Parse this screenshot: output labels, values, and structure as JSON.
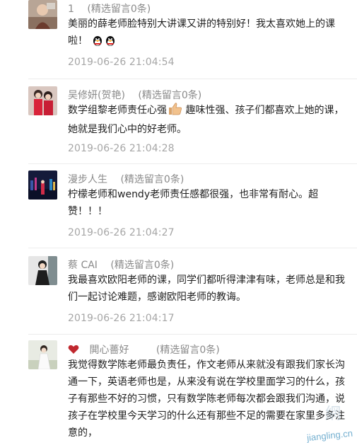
{
  "comments": [
    {
      "name": "1",
      "tag": "(精选留言0条)",
      "text": "美丽的薛老师脸特别大讲课又讲的特别好！我太喜欢她上的课啦！",
      "emoji": "qq-penguin-icon",
      "time": "2019-06-26 21:04:54"
    },
    {
      "name": "吴修妍(贺艳)",
      "tag": "(精选留言0条)",
      "text_before": "数学组黎老师责任心强",
      "emoji": "thumbs-up-icon",
      "text_after": "趣味性强、孩子们都喜欢上她的课，她就是我们心中的好老师。",
      "time": "2019-06-26 21:04:28"
    },
    {
      "name": "漫步人生",
      "tag": "(精选留言0条)",
      "text": "柠檬老师和wendy老师责任感都很强，也非常有耐心。超赞！！！",
      "time": "2019-06-26 21:04:27"
    },
    {
      "name": "蔡 CAI",
      "tag": "(精选留言0条)",
      "text": "我最喜欢欧阳老师的课，同学们都听得津津有味，老师总是和我们一起讨论难题，感谢欧阳老师的教诲。",
      "time": "2019-06-26 21:04:17"
    },
    {
      "name": "閧心薔好",
      "tag": "(精选留言0条)",
      "icon": "heart-icon",
      "text": "我觉得数学陈老师最负责任，作文老师从来就没有跟我们家长沟通一下，英语老师也是，从来没有说在学校里面学习的什么，孩子有那些不好的习惯，只有数学陈老师每次都会跟我们沟通，说孩子在学校里今天学习的什么还有那些不足的需要在家里多多注意的，"
    }
  ],
  "watermark": {
    "text": "jiangling.cn"
  },
  "colors": {
    "meta": "#8a8a8a",
    "time": "#a6a6a6",
    "divider": "#ececec",
    "heart": "#c0282f"
  }
}
